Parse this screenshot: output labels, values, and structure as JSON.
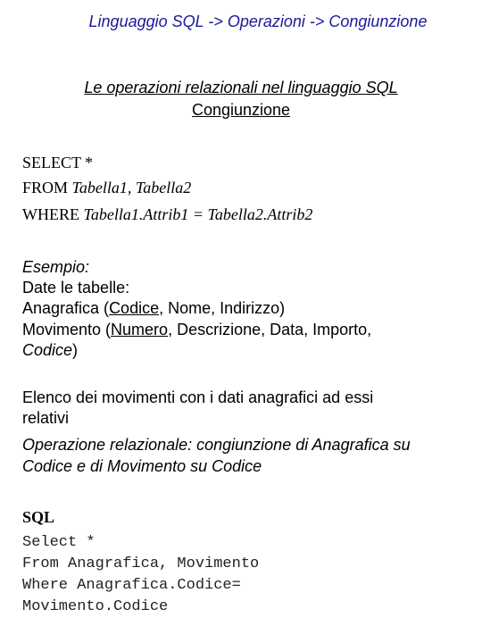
{
  "header": {
    "breadcrumb": "Linguaggio SQL -> Operazioni ->  Congiunzione",
    "color": "#1a1a99"
  },
  "title": {
    "line1": "Le operazioni relazionali nel linguaggio SQL",
    "line2": "Congiunzione"
  },
  "syntax": {
    "select_kw": "SELECT *",
    "from_kw": "FROM",
    "from_args": "Tabella1, Tabella2",
    "where_kw": "WHERE",
    "where_args": "Tabella1.Attrib1 = Tabella2.Attrib2"
  },
  "example": {
    "label": "Esempio:",
    "intro": "Date le tabelle:",
    "anagrafica": {
      "name": "Anagrafica (",
      "key": "Codice",
      "rest": ", Nome, Indirizzo)"
    },
    "movimento": {
      "name": "Movimento (",
      "key": "Numero",
      "rest": ", Descrizione, Data, Importo,",
      "fk": "Codice",
      "close": ")"
    },
    "request_line1": "Elenco dei movimenti con i dati anagrafici ad essi",
    "request_line2": "relativi",
    "operation_line1": "Operazione relazionale: congiunzione di Anagrafica su",
    "operation_line2": "Codice e di Movimento su Codice"
  },
  "sql": {
    "label": "SQL",
    "lines": [
      "Select *",
      "From Anagrafica, Movimento",
      "Where Anagrafica.Codice=",
      "Movimento.Codice"
    ]
  }
}
